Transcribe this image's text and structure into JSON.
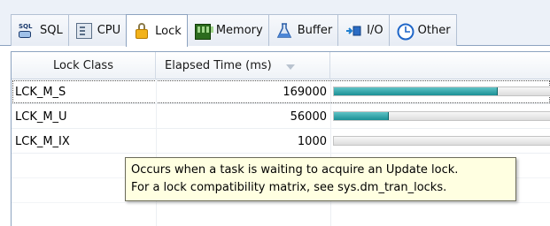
{
  "tabs": [
    {
      "label": "SQL",
      "icon": "sql-database-icon",
      "active": false
    },
    {
      "label": "CPU",
      "icon": "cpu-icon",
      "active": false
    },
    {
      "label": "Lock",
      "icon": "lock-icon",
      "active": true
    },
    {
      "label": "Memory",
      "icon": "memory-chip-icon",
      "active": false
    },
    {
      "label": "Buffer",
      "icon": "flask-icon",
      "active": false
    },
    {
      "label": "I/O",
      "icon": "io-arrow-icon",
      "active": false
    },
    {
      "label": "Other",
      "icon": "clock-icon",
      "active": false
    }
  ],
  "grid": {
    "columns": {
      "lock_class": "Lock Class",
      "elapsed_time": "Elapsed Time (ms)",
      "bar": ""
    },
    "sort": {
      "column": "elapsed_time",
      "direction": "descending"
    },
    "rows": [
      {
        "lock_class": "LCK_M_S",
        "elapsed_ms": "169000",
        "bar_fraction": 0.75,
        "selected": true
      },
      {
        "lock_class": "LCK_M_U",
        "elapsed_ms": "56000",
        "bar_fraction": 0.25,
        "selected": false
      },
      {
        "lock_class": "LCK_M_IX",
        "elapsed_ms": "1000",
        "bar_fraction": 0.0,
        "selected": false
      }
    ]
  },
  "tooltip": {
    "line1": "Occurs when a task is waiting to acquire an Update lock.",
    "line2": "For a lock compatibility matrix, see sys.dm_tran_locks."
  },
  "colors": {
    "bar_fill": "#1a8f95",
    "tooltip_bg": "#ffffe1",
    "active_tab_icon": "#f2b21a"
  }
}
